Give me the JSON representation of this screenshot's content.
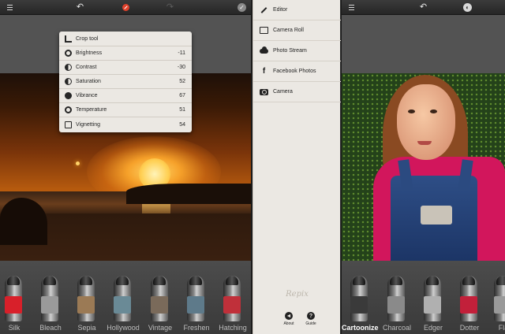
{
  "left_screen": {
    "adjust_menu": [
      {
        "icon": "crop-icon",
        "label": "Crop tool",
        "value": ""
      },
      {
        "icon": "brightness-icon",
        "label": "Brightness",
        "value": "-11"
      },
      {
        "icon": "contrast-icon",
        "label": "Contrast",
        "value": "-30"
      },
      {
        "icon": "saturation-icon",
        "label": "Saturation",
        "value": "52"
      },
      {
        "icon": "vibrance-icon",
        "label": "Vibrance",
        "value": "67"
      },
      {
        "icon": "temperature-icon",
        "label": "Temperature",
        "value": "51"
      },
      {
        "icon": "vignetting-icon",
        "label": "Vignetting",
        "value": "54"
      }
    ],
    "effects": [
      {
        "label": "Silk",
        "color": "#d8202a"
      },
      {
        "label": "Bleach",
        "color": "#9a9a9a"
      },
      {
        "label": "Sepia",
        "color": "#9b7a55"
      },
      {
        "label": "Hollywood",
        "color": "#6a8a96"
      },
      {
        "label": "Vintage",
        "color": "#7a6a5a"
      },
      {
        "label": "Freshen",
        "color": "#5e7a8a"
      },
      {
        "label": "Hatching",
        "color": "#c0303a"
      }
    ]
  },
  "middle_panel": {
    "menu": [
      {
        "icon": "pencil-icon",
        "label": "Editor"
      },
      {
        "icon": "photo-icon",
        "label": "Camera Roll"
      },
      {
        "icon": "cloud-icon",
        "label": "Photo Stream"
      },
      {
        "icon": "facebook-icon",
        "label": "Facebook Photos"
      },
      {
        "icon": "camera-icon",
        "label": "Camera"
      }
    ],
    "brand": "Repix",
    "about_label": "About",
    "guide_label": "Guide"
  },
  "right_screen": {
    "effects": [
      {
        "label": "Cartoonize",
        "color": "#3a3a3a",
        "active": true
      },
      {
        "label": "Charcoal",
        "color": "#8a8a8a",
        "active": false
      },
      {
        "label": "Edger",
        "color": "#b0b0b0",
        "active": false
      },
      {
        "label": "Dotter",
        "color": "#c2203a",
        "active": false
      },
      {
        "label": "Fla",
        "color": "#9a9a9a",
        "active": false
      }
    ]
  }
}
